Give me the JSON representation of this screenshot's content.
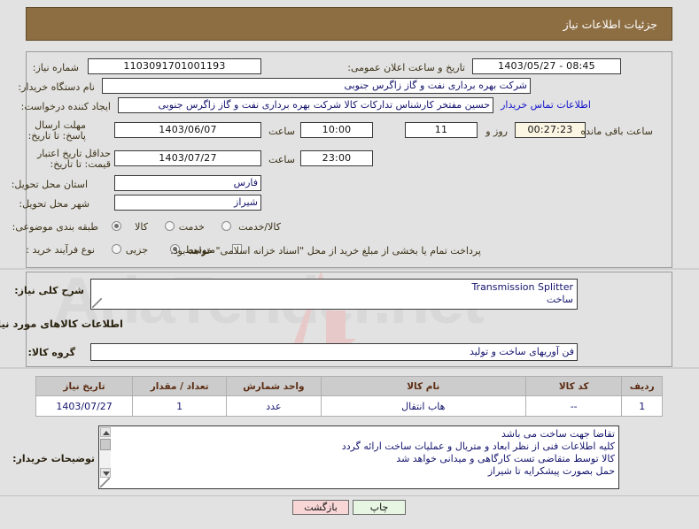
{
  "header": {
    "title": "جزئیات اطلاعات نیاز"
  },
  "colors": {
    "header_bg": "#8d6e43",
    "page_bg": "#e2e2e2",
    "link": "#1515cc",
    "field_text": "#14146e",
    "table_header_bg": "#cccccc",
    "table_header_text": "#5c2c12",
    "print_btn_bg": "#e7f6e2",
    "back_btn_bg": "#f9d6d6",
    "countdown_bg": "#fbf6e4"
  },
  "watermark": {
    "text": "AriaTender.net"
  },
  "main": {
    "need_number_label": "شماره نیاز:",
    "need_number_value": "1103091701001193",
    "public_announce_label": "تاریخ و ساعت اعلان عمومی:",
    "public_announce_value": "08:45 - 1403/05/27",
    "buyer_org_label": "نام دستگاه خریدار:",
    "buyer_org_value": "شرکت بهره برداری نفت و گاز زاگرس جنوبی",
    "creator_label": "ایجاد کننده درخواست:",
    "creator_value": "حسین مفتخر کارشناس تدارکات کالا شرکت بهره برداری نفت و گاز زاگرس جنوبی",
    "buyer_contact_link": "اطلاعات تماس خریدار",
    "reply_deadline_label": "مهلت ارسال پاسخ: تا تاریخ:",
    "reply_deadline_date": "1403/06/07",
    "reply_deadline_hour_label": "ساعت",
    "reply_deadline_time": "10:00",
    "countdown_days": "11",
    "countdown_days_suffix": "روز و",
    "countdown_clock": "00:27:23",
    "countdown_suffix": "ساعت باقی مانده",
    "price_validity_label": "حداقل تاریخ اعتبار قیمت: تا تاریخ:",
    "price_validity_date": "1403/07/27",
    "price_validity_hour_label": "ساعت",
    "price_validity_time": "23:00",
    "province_label": "استان محل تحویل:",
    "province_value": "فارس",
    "city_label": "شهر محل تحویل:",
    "city_value": "شیراز",
    "category_label": "طبقه بندی موضوعی:",
    "category_options": [
      {
        "label": "کالا",
        "selected": true
      },
      {
        "label": "خدمت",
        "selected": false
      },
      {
        "label": "کالا/خدمت",
        "selected": false
      }
    ],
    "process_type_label": "نوع فرآیند خرید :",
    "process_type_options": [
      {
        "label": "جزیی",
        "selected": false
      },
      {
        "label": "متوسط",
        "selected": true
      }
    ],
    "treasury_checkbox_label": "پرداخت تمام یا بخشی از مبلغ خرید از محل \"اسناد خزانه اسلامی\" خواهد بود.",
    "treasury_checkbox_checked": false
  },
  "description": {
    "overall_need_label": "شرح کلی نیاز:",
    "overall_need_value": "Transmission Splitter\nساخت",
    "goods_info_heading": "اطلاعات کالاهای مورد نیاز",
    "goods_group_label": "گروه کالا:",
    "goods_group_value": "فن آوریهای ساخت و تولید"
  },
  "items_table": {
    "columns": [
      "ردیف",
      "کد کالا",
      "نام کالا",
      "واحد شمارش",
      "تعداد / مقدار",
      "تاریخ نیاز"
    ],
    "rows": [
      [
        "1",
        "--",
        "هاب انتقال",
        "عدد",
        "1",
        "1403/07/27"
      ]
    ]
  },
  "buyer_notes": {
    "label": "توضیحات خریدار:",
    "lines": [
      "تقاضا جهت ساخت می باشد",
      "کلیه اطلاعات فنی از نظر ابعاد و متریال و عملیات ساخت ارائه گردد",
      "کالا توسط متقاضی تست کارگاهی و میدانی خواهد شد",
      "حمل بصورت پیشکرایه تا شیراز"
    ]
  },
  "footer": {
    "print_label": "چاپ",
    "back_label": "بازگشت"
  }
}
